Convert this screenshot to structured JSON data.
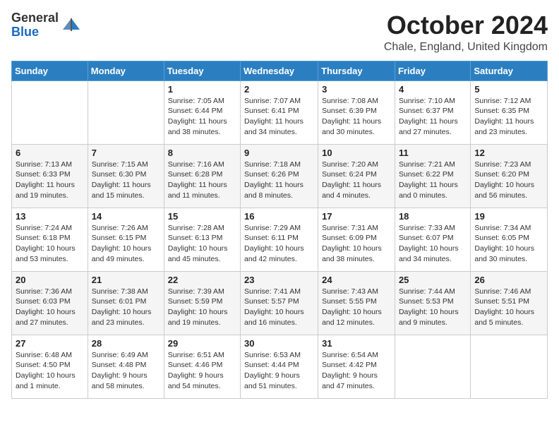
{
  "logo": {
    "general": "General",
    "blue": "Blue"
  },
  "header": {
    "month": "October 2024",
    "location": "Chale, England, United Kingdom"
  },
  "weekdays": [
    "Sunday",
    "Monday",
    "Tuesday",
    "Wednesday",
    "Thursday",
    "Friday",
    "Saturday"
  ],
  "weeks": [
    [
      {
        "day": "",
        "info": ""
      },
      {
        "day": "",
        "info": ""
      },
      {
        "day": "1",
        "info": "Sunrise: 7:05 AM\nSunset: 6:44 PM\nDaylight: 11 hours and 38 minutes."
      },
      {
        "day": "2",
        "info": "Sunrise: 7:07 AM\nSunset: 6:41 PM\nDaylight: 11 hours and 34 minutes."
      },
      {
        "day": "3",
        "info": "Sunrise: 7:08 AM\nSunset: 6:39 PM\nDaylight: 11 hours and 30 minutes."
      },
      {
        "day": "4",
        "info": "Sunrise: 7:10 AM\nSunset: 6:37 PM\nDaylight: 11 hours and 27 minutes."
      },
      {
        "day": "5",
        "info": "Sunrise: 7:12 AM\nSunset: 6:35 PM\nDaylight: 11 hours and 23 minutes."
      }
    ],
    [
      {
        "day": "6",
        "info": "Sunrise: 7:13 AM\nSunset: 6:33 PM\nDaylight: 11 hours and 19 minutes."
      },
      {
        "day": "7",
        "info": "Sunrise: 7:15 AM\nSunset: 6:30 PM\nDaylight: 11 hours and 15 minutes."
      },
      {
        "day": "8",
        "info": "Sunrise: 7:16 AM\nSunset: 6:28 PM\nDaylight: 11 hours and 11 minutes."
      },
      {
        "day": "9",
        "info": "Sunrise: 7:18 AM\nSunset: 6:26 PM\nDaylight: 11 hours and 8 minutes."
      },
      {
        "day": "10",
        "info": "Sunrise: 7:20 AM\nSunset: 6:24 PM\nDaylight: 11 hours and 4 minutes."
      },
      {
        "day": "11",
        "info": "Sunrise: 7:21 AM\nSunset: 6:22 PM\nDaylight: 11 hours and 0 minutes."
      },
      {
        "day": "12",
        "info": "Sunrise: 7:23 AM\nSunset: 6:20 PM\nDaylight: 10 hours and 56 minutes."
      }
    ],
    [
      {
        "day": "13",
        "info": "Sunrise: 7:24 AM\nSunset: 6:18 PM\nDaylight: 10 hours and 53 minutes."
      },
      {
        "day": "14",
        "info": "Sunrise: 7:26 AM\nSunset: 6:15 PM\nDaylight: 10 hours and 49 minutes."
      },
      {
        "day": "15",
        "info": "Sunrise: 7:28 AM\nSunset: 6:13 PM\nDaylight: 10 hours and 45 minutes."
      },
      {
        "day": "16",
        "info": "Sunrise: 7:29 AM\nSunset: 6:11 PM\nDaylight: 10 hours and 42 minutes."
      },
      {
        "day": "17",
        "info": "Sunrise: 7:31 AM\nSunset: 6:09 PM\nDaylight: 10 hours and 38 minutes."
      },
      {
        "day": "18",
        "info": "Sunrise: 7:33 AM\nSunset: 6:07 PM\nDaylight: 10 hours and 34 minutes."
      },
      {
        "day": "19",
        "info": "Sunrise: 7:34 AM\nSunset: 6:05 PM\nDaylight: 10 hours and 30 minutes."
      }
    ],
    [
      {
        "day": "20",
        "info": "Sunrise: 7:36 AM\nSunset: 6:03 PM\nDaylight: 10 hours and 27 minutes."
      },
      {
        "day": "21",
        "info": "Sunrise: 7:38 AM\nSunset: 6:01 PM\nDaylight: 10 hours and 23 minutes."
      },
      {
        "day": "22",
        "info": "Sunrise: 7:39 AM\nSunset: 5:59 PM\nDaylight: 10 hours and 19 minutes."
      },
      {
        "day": "23",
        "info": "Sunrise: 7:41 AM\nSunset: 5:57 PM\nDaylight: 10 hours and 16 minutes."
      },
      {
        "day": "24",
        "info": "Sunrise: 7:43 AM\nSunset: 5:55 PM\nDaylight: 10 hours and 12 minutes."
      },
      {
        "day": "25",
        "info": "Sunrise: 7:44 AM\nSunset: 5:53 PM\nDaylight: 10 hours and 9 minutes."
      },
      {
        "day": "26",
        "info": "Sunrise: 7:46 AM\nSunset: 5:51 PM\nDaylight: 10 hours and 5 minutes."
      }
    ],
    [
      {
        "day": "27",
        "info": "Sunrise: 6:48 AM\nSunset: 4:50 PM\nDaylight: 10 hours and 1 minute."
      },
      {
        "day": "28",
        "info": "Sunrise: 6:49 AM\nSunset: 4:48 PM\nDaylight: 9 hours and 58 minutes."
      },
      {
        "day": "29",
        "info": "Sunrise: 6:51 AM\nSunset: 4:46 PM\nDaylight: 9 hours and 54 minutes."
      },
      {
        "day": "30",
        "info": "Sunrise: 6:53 AM\nSunset: 4:44 PM\nDaylight: 9 hours and 51 minutes."
      },
      {
        "day": "31",
        "info": "Sunrise: 6:54 AM\nSunset: 4:42 PM\nDaylight: 9 hours and 47 minutes."
      },
      {
        "day": "",
        "info": ""
      },
      {
        "day": "",
        "info": ""
      }
    ]
  ]
}
